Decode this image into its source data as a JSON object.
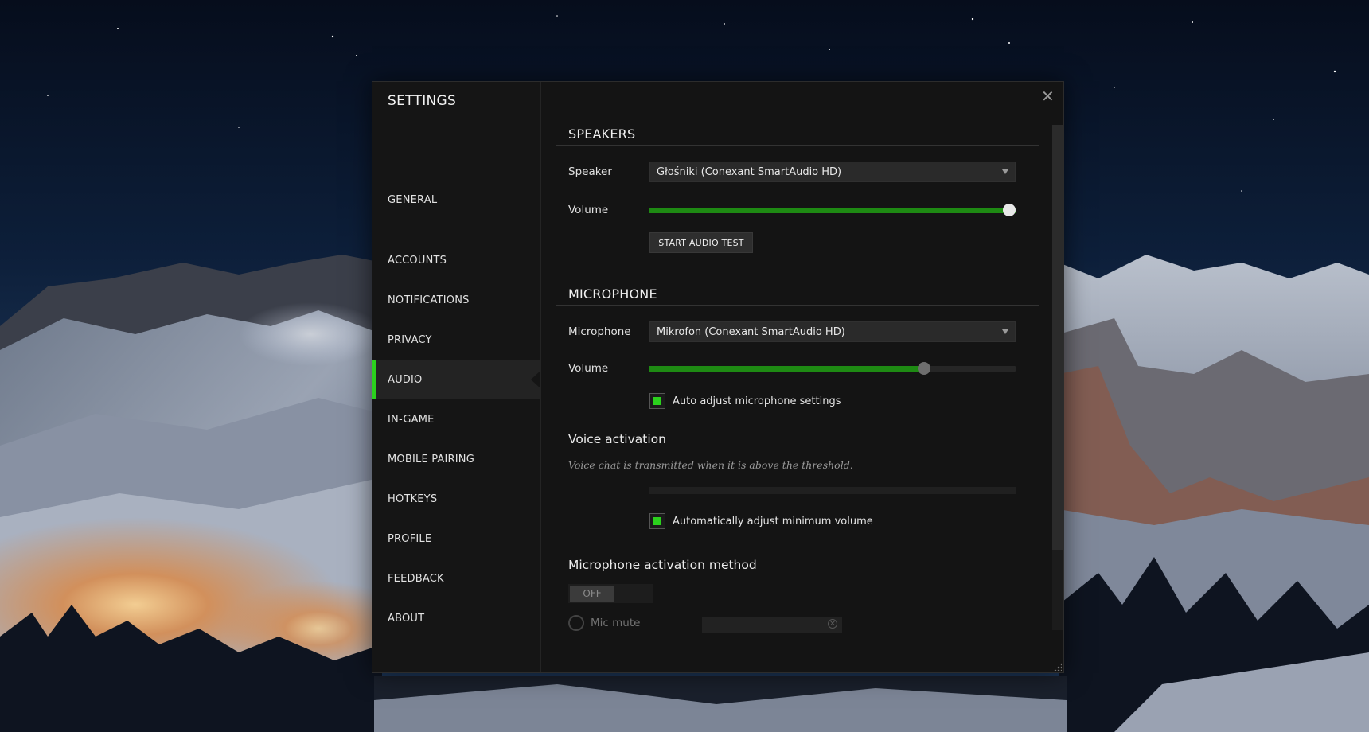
{
  "sidebar": {
    "title": "SETTINGS",
    "items": [
      {
        "label": "GENERAL"
      },
      {
        "label": "ACCOUNTS"
      },
      {
        "label": "NOTIFICATIONS"
      },
      {
        "label": "PRIVACY"
      },
      {
        "label": "AUDIO",
        "active": true
      },
      {
        "label": "IN-GAME"
      },
      {
        "label": "MOBILE PAIRING"
      },
      {
        "label": "HOTKEYS"
      },
      {
        "label": "PROFILE"
      },
      {
        "label": "FEEDBACK"
      },
      {
        "label": "ABOUT"
      }
    ]
  },
  "window": {
    "close_icon": "✕"
  },
  "speakers": {
    "heading": "SPEAKERS",
    "speaker_label": "Speaker",
    "speaker_value": "Głośniki (Conexant SmartAudio HD)",
    "volume_label": "Volume",
    "volume_percent": 100,
    "audio_test_button": "START AUDIO TEST"
  },
  "microphone": {
    "heading": "MICROPHONE",
    "microphone_label": "Microphone",
    "microphone_value": "Mikrofon (Conexant SmartAudio HD)",
    "volume_label": "Volume",
    "volume_percent": 75,
    "auto_adjust_label": "Auto adjust microphone settings",
    "auto_adjust_checked": true
  },
  "voice_activation": {
    "heading": "Voice activation",
    "hint": "Voice chat is transmitted when it is above the threshold.",
    "auto_min_volume_label": "Automatically adjust minimum volume",
    "auto_min_volume_checked": true
  },
  "activation_method": {
    "heading": "Microphone activation method",
    "toggle_label": "OFF",
    "mic_mute_label": "Mic mute",
    "clear_icon": "×"
  },
  "colors": {
    "accent": "#2bd11d",
    "slider_fill": "#1e8a13",
    "slider_thumb": "#e8e8e8",
    "slider_thumb_mic": "#6e6e6e"
  }
}
